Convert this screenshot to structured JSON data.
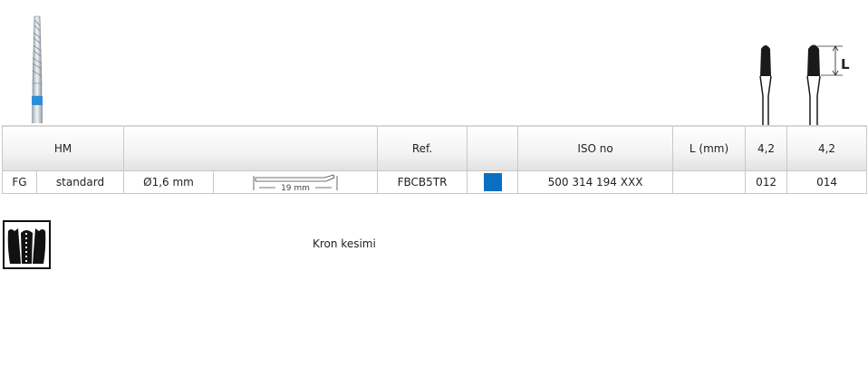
{
  "header": {
    "material": "HM",
    "ref_label": "Ref.",
    "iso_label": "ISO no",
    "length_label": "L (mm)",
    "size_1": "4,2",
    "size_2": "4,2"
  },
  "diagram": {
    "length_marker": "L"
  },
  "row": {
    "shank": "FG",
    "type": "standard",
    "diameter": "Ø1,6 mm",
    "overall_length": "19 mm",
    "ref": "FBCB5TR",
    "iso": "500 314 194 XXX",
    "length": "",
    "size_code_1": "012",
    "size_code_2": "014",
    "color": "#0a6fc2"
  },
  "application": {
    "label": "Kron kesimi",
    "icon": "crown-cutting-icon"
  }
}
